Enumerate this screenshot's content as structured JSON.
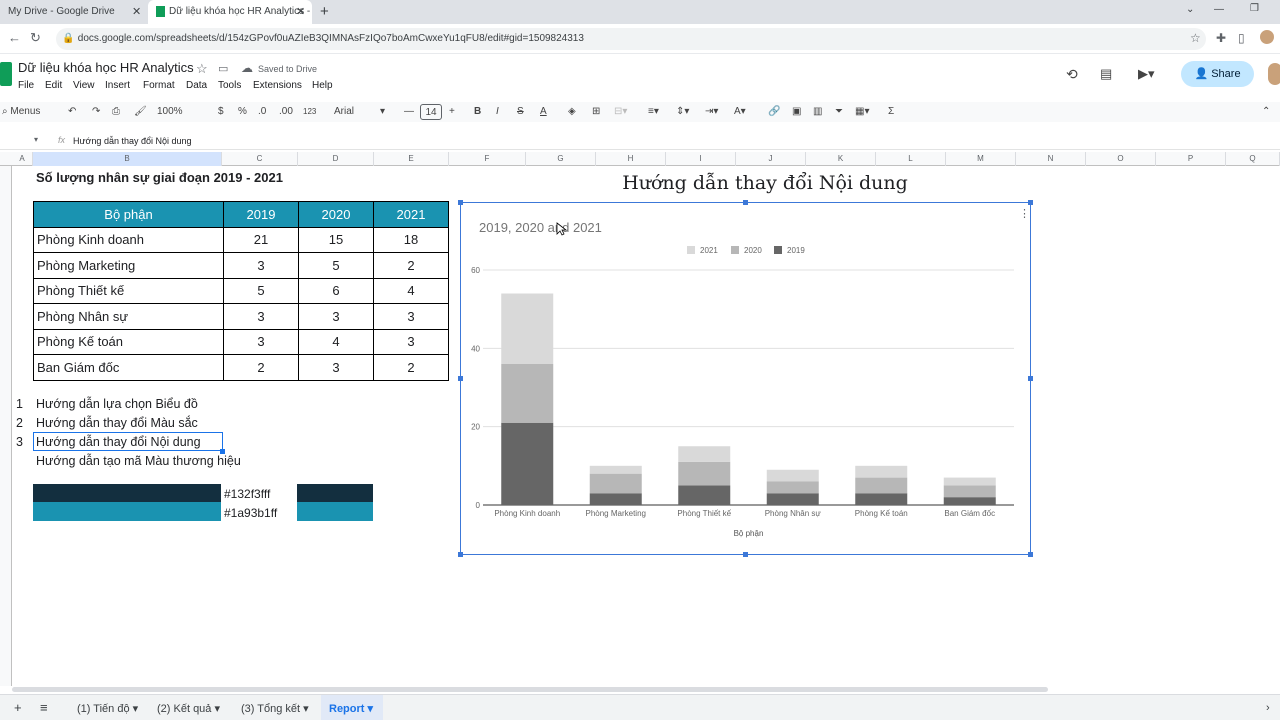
{
  "browser": {
    "tabs": [
      {
        "title": "My Drive - Google Drive",
        "close": "✕"
      },
      {
        "title": "Dữ liệu khóa học HR Analytics -",
        "close": "✕"
      }
    ],
    "new_tab": "+",
    "url": "docs.google.com/spreadsheets/d/154zGPovf0uAZIeB3QIMNAsFzIQo7boAmCwxeYu1qFU8/edit#gid=1509824313"
  },
  "sheets": {
    "title": "Dữ liệu khóa học HR Analytics",
    "saved": "Saved to Drive",
    "menu": [
      "File",
      "Edit",
      "View",
      "Insert",
      "Format",
      "Data",
      "Tools",
      "Extensions",
      "Help"
    ],
    "share": "Share",
    "toolbar": {
      "menus": "Menus",
      "zoom": "100%",
      "currency": "$",
      "percent": "%",
      "dec_minus": ".0",
      "dec_plus": ".00",
      "format": "123",
      "font": "Arial",
      "font_size": "14",
      "sigma": "Σ"
    },
    "formula": "Hướng dẫn thay đổi Nội dung",
    "columns": [
      "A",
      "B",
      "C",
      "D",
      "E",
      "F",
      "G",
      "H",
      "I",
      "J",
      "K",
      "L",
      "M",
      "N",
      "O",
      "P",
      "Q"
    ],
    "heading": "Số lượng nhân sự giai đoạn 2019 - 2021",
    "table": {
      "headers": [
        "Bộ phận",
        "2019",
        "2020",
        "2021"
      ],
      "rows": [
        [
          "Phòng Kinh doanh",
          "21",
          "15",
          "18"
        ],
        [
          "Phòng Marketing",
          "3",
          "5",
          "2"
        ],
        [
          "Phòng Thiết kế",
          "5",
          "6",
          "4"
        ],
        [
          "Phòng Nhân sự",
          "3",
          "3",
          "3"
        ],
        [
          "Phòng Kế toán",
          "3",
          "4",
          "3"
        ],
        [
          "Ban Giám đốc",
          "2",
          "3",
          "2"
        ]
      ]
    },
    "guides": [
      {
        "num": "1",
        "text": "Hướng dẫn lựa chọn Biểu đồ"
      },
      {
        "num": "2",
        "text": "Hướng dẫn thay đổi Màu sắc"
      },
      {
        "num": "3",
        "text": "Hướng dẫn thay đổi Nội dung"
      },
      {
        "num": "",
        "text": "Hướng dẫn tạo mã Màu thương hiệu"
      }
    ],
    "colors": [
      {
        "code": "#132f3fff",
        "hex": "#132f3f"
      },
      {
        "code": "#1a93b1ff",
        "hex": "#1a93b1"
      }
    ],
    "sheet_tabs": [
      "(1) Tiến độ",
      "(2) Kết quả",
      "(3) Tổng kết",
      "Report"
    ]
  },
  "chart_title_cell": "Hướng dẫn thay đổi Nội dung",
  "chart_data": {
    "type": "bar",
    "stacked": true,
    "title": "2019, 2020 and 2021",
    "xlabel": "Bộ phận",
    "ylabel": "",
    "ylim": [
      0,
      60
    ],
    "yticks": [
      "0",
      "20",
      "40",
      "60"
    ],
    "categories": [
      "Phòng Kinh doanh",
      "Phòng Marketing",
      "Phòng Thiết kế",
      "Phòng Nhân sự",
      "Phòng Kế toán",
      "Ban Giám đốc"
    ],
    "series": [
      {
        "name": "2019",
        "values": [
          21,
          3,
          5,
          3,
          3,
          2
        ],
        "color": "#666666"
      },
      {
        "name": "2020",
        "values": [
          15,
          5,
          6,
          3,
          4,
          3
        ],
        "color": "#b7b7b7"
      },
      {
        "name": "2021",
        "values": [
          18,
          2,
          4,
          3,
          3,
          2
        ],
        "color": "#d9d9d9"
      }
    ],
    "legend_order": [
      "2021",
      "2020",
      "2019"
    ],
    "legend": "top",
    "grid": true
  }
}
